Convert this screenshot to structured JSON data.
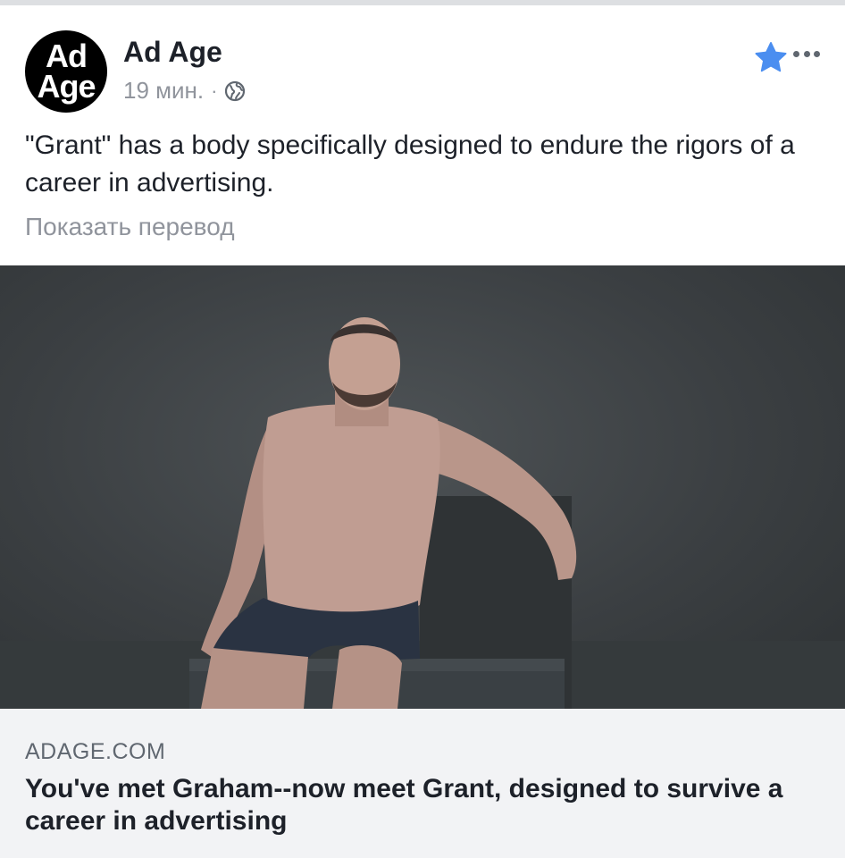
{
  "post": {
    "page_name": "Ad Age",
    "avatar_text": [
      "Ad",
      "Age"
    ],
    "timestamp": "19 мин.",
    "separator": "·",
    "privacy_icon": "globe-icon",
    "saved_icon": "star-icon",
    "menu_icon": "more-icon",
    "text": "\"Grant\" has a body specifically designed to endure the rigors of a career in advertising.",
    "translate_label": "Показать перевод"
  },
  "link": {
    "domain": "ADAGE.COM",
    "title": "You've met Graham--now meet Grant, designed to survive a career in advertising"
  },
  "colors": {
    "star": "#4b8ef0",
    "text": "#1d2129",
    "muted": "#90949c",
    "preview_bg": "#f2f3f5"
  }
}
